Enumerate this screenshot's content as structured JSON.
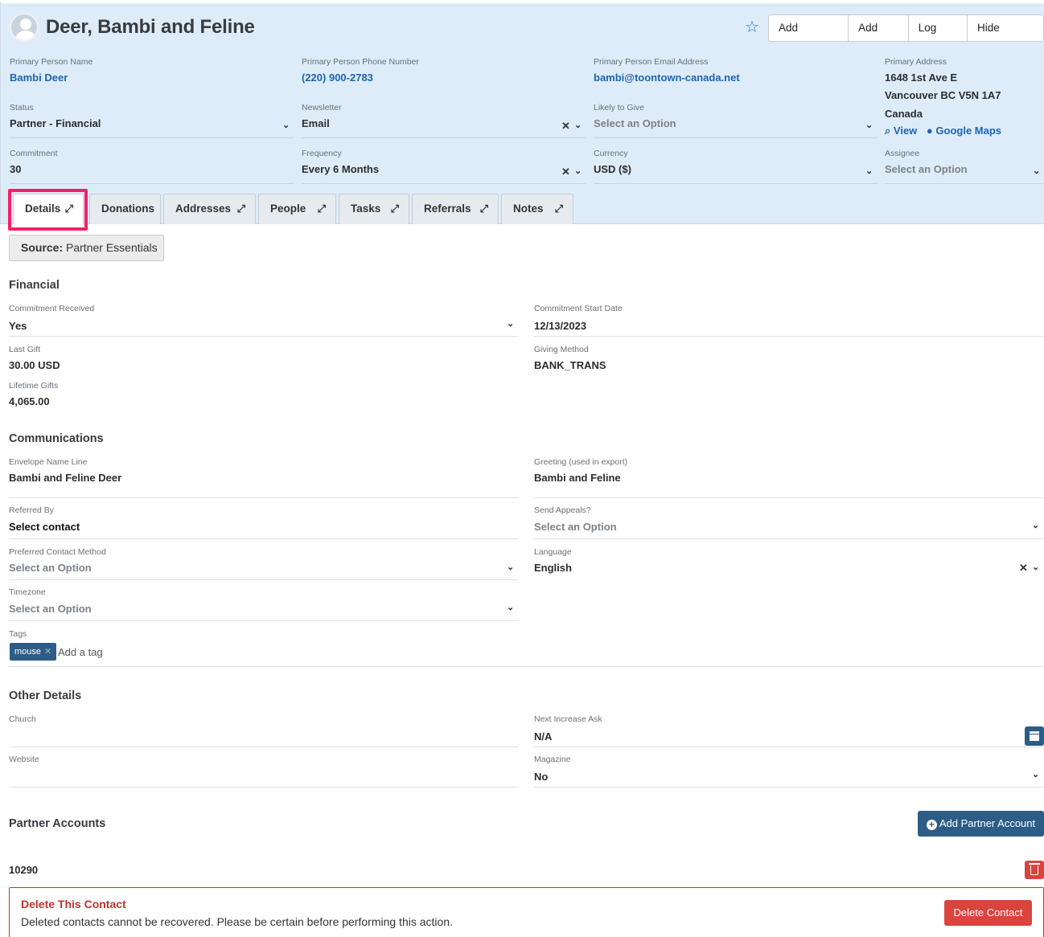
{
  "header": {
    "contact_name": "Deer, Bambi and Feline",
    "buttons": [
      "Add Referrals",
      "Add Task",
      "Log Task",
      "Hide Contact"
    ],
    "primary_person_name": {
      "label": "Primary Person Name",
      "value": "Bambi Deer"
    },
    "primary_phone": {
      "label": "Primary Person Phone Number",
      "value": "(220) 900-2783"
    },
    "primary_email": {
      "label": "Primary Person Email Address",
      "value": "bambi@toontown-canada.net"
    },
    "primary_address": {
      "label": "Primary Address",
      "line1": "1648 1st Ave E",
      "line2": "Vancouver BC V5N 1A7",
      "line3": "Canada",
      "view": "View",
      "maps": "Google Maps"
    },
    "status": {
      "label": "Status",
      "value": "Partner - Financial"
    },
    "newsletter": {
      "label": "Newsletter",
      "value": "Email"
    },
    "likely_to_give": {
      "label": "Likely to Give",
      "value": "Select an Option"
    },
    "commitment": {
      "label": "Commitment",
      "value": "30"
    },
    "frequency": {
      "label": "Frequency",
      "value": "Every 6 Months"
    },
    "currency": {
      "label": "Currency",
      "value": "USD ($)"
    },
    "assignee": {
      "label": "Assignee",
      "value": "Select an Option"
    }
  },
  "tabs": [
    "Details",
    "Donations",
    "Addresses",
    "People",
    "Tasks",
    "Referrals",
    "Notes"
  ],
  "source": {
    "label": "Source:",
    "value": "Partner Essentials"
  },
  "financial": {
    "title": "Financial",
    "commitment_received": {
      "label": "Commitment Received",
      "value": "Yes"
    },
    "commitment_start": {
      "label": "Commitment Start Date",
      "value": "12/13/2023"
    },
    "last_gift": {
      "label": "Last Gift",
      "value": "30.00 USD"
    },
    "giving_method": {
      "label": "Giving Method",
      "value": "BANK_TRANS"
    },
    "lifetime_gifts": {
      "label": "Lifetime Gifts",
      "value": "4,065.00"
    }
  },
  "communications": {
    "title": "Communications",
    "envelope": {
      "label": "Envelope Name Line",
      "value": "Bambi and Feline Deer"
    },
    "greeting": {
      "label": "Greeting (used in export)",
      "value": "Bambi and Feline"
    },
    "referred_by": {
      "label": "Referred By",
      "value": "Select contact"
    },
    "send_appeals": {
      "label": "Send Appeals?",
      "value": "Select an Option"
    },
    "preferred_contact": {
      "label": "Preferred Contact Method",
      "value": "Select an Option"
    },
    "language": {
      "label": "Language",
      "value": "English"
    },
    "timezone": {
      "label": "Timezone",
      "value": "Select an Option"
    },
    "tags": {
      "label": "Tags",
      "items": [
        "mouse"
      ],
      "add_placeholder": "Add a tag"
    }
  },
  "other": {
    "title": "Other Details",
    "church": {
      "label": "Church",
      "value": ""
    },
    "next_increase": {
      "label": "Next Increase Ask",
      "value": "N/A"
    },
    "website": {
      "label": "Website",
      "value": ""
    },
    "magazine": {
      "label": "Magazine",
      "value": "No"
    }
  },
  "partner_accounts": {
    "title": "Partner Accounts",
    "add_label": "Add Partner Account",
    "accounts": [
      "10290"
    ]
  },
  "danger": {
    "title": "Delete This Contact",
    "description": "Deleted contacts cannot be recovered. Please be certain before performing this action.",
    "button": "Delete Contact"
  },
  "colors": {
    "accent": "#2c5d88",
    "link": "#1d63b3",
    "danger": "#d9443f",
    "highlight": "#f0226a",
    "header_bg": "#deecf9"
  }
}
